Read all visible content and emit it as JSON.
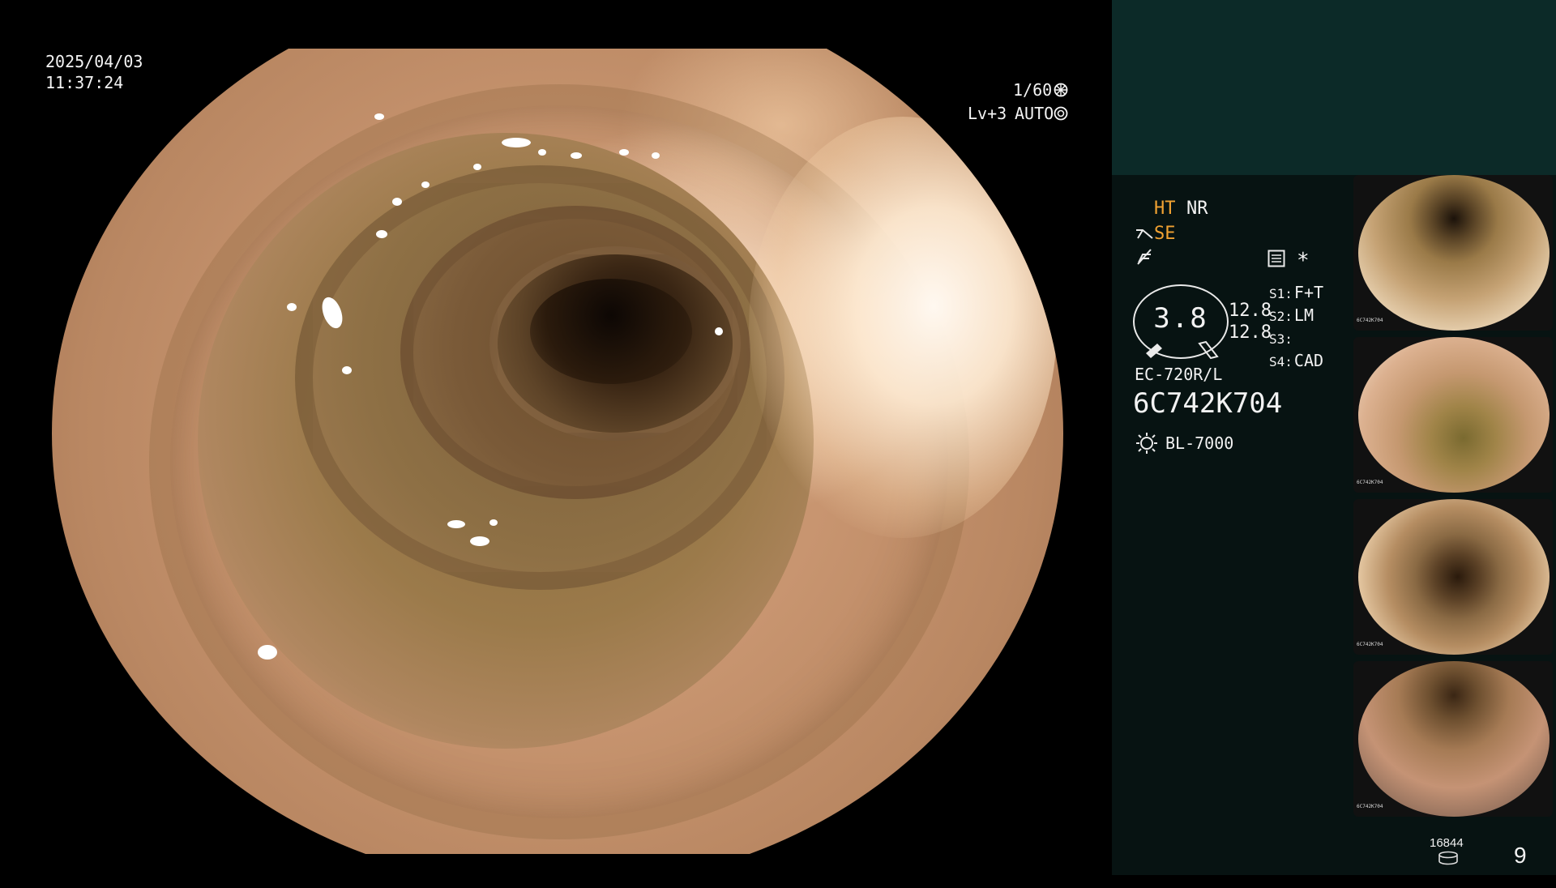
{
  "overlay": {
    "date": "2025/04/03",
    "time": "11:37:24",
    "shutter": "1/60",
    "level": "Lv+3",
    "mode": "AUTO"
  },
  "panel": {
    "ht": "HT",
    "nr": "NR",
    "se": "SE",
    "gauge_value": "3.8",
    "val_a": "12.8",
    "val_b": "12.8",
    "settings": [
      {
        "key": "S1:",
        "value": "F+T"
      },
      {
        "key": "S2:",
        "value": "LM"
      },
      {
        "key": "S3:",
        "value": ""
      },
      {
        "key": "S4:",
        "value": "CAD"
      }
    ],
    "scope_model": "EC-720R/L",
    "serial": "6C742K704",
    "light_source": "BL-7000",
    "asterisk": "*",
    "storage_count": "16844",
    "page_number": "9"
  },
  "thumbnails": [
    {
      "label": "6C742K704"
    },
    {
      "label": "6C742K704"
    },
    {
      "label": "6C742K704"
    },
    {
      "label": "6C742K704"
    }
  ],
  "icons": {
    "shutter": "aperture-icon",
    "auto": "iris-icon",
    "scissors": "cut-icon",
    "signal": "signal-off-icon",
    "settings": "settings-list-icon",
    "light": "light-source-icon",
    "storage": "storage-disk-icon"
  },
  "colors": {
    "accent": "#f1a232",
    "panel_bg": "#071312",
    "panel_header_bg": "#0c2a28"
  }
}
